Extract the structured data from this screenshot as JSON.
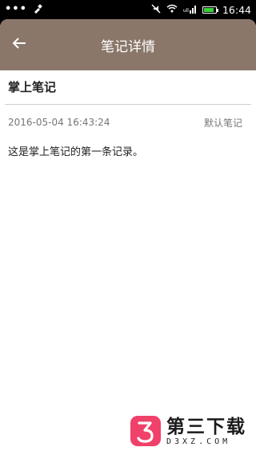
{
  "status_bar": {
    "dots": "•••",
    "time": "16:44",
    "battery_level": 0.85,
    "signal_label": "ull"
  },
  "toolbar": {
    "title": "笔记详情"
  },
  "note": {
    "title": "掌上笔记",
    "datetime": "2016-05-04 16:43:24",
    "category": "默认笔记",
    "content": "这是掌上笔记的第一条记录。"
  },
  "watermark": {
    "name": "第三下载",
    "url": "D3XZ.COM"
  },
  "colors": {
    "toolbar": "#8a7769",
    "watermark_logo": "#f0416a"
  }
}
